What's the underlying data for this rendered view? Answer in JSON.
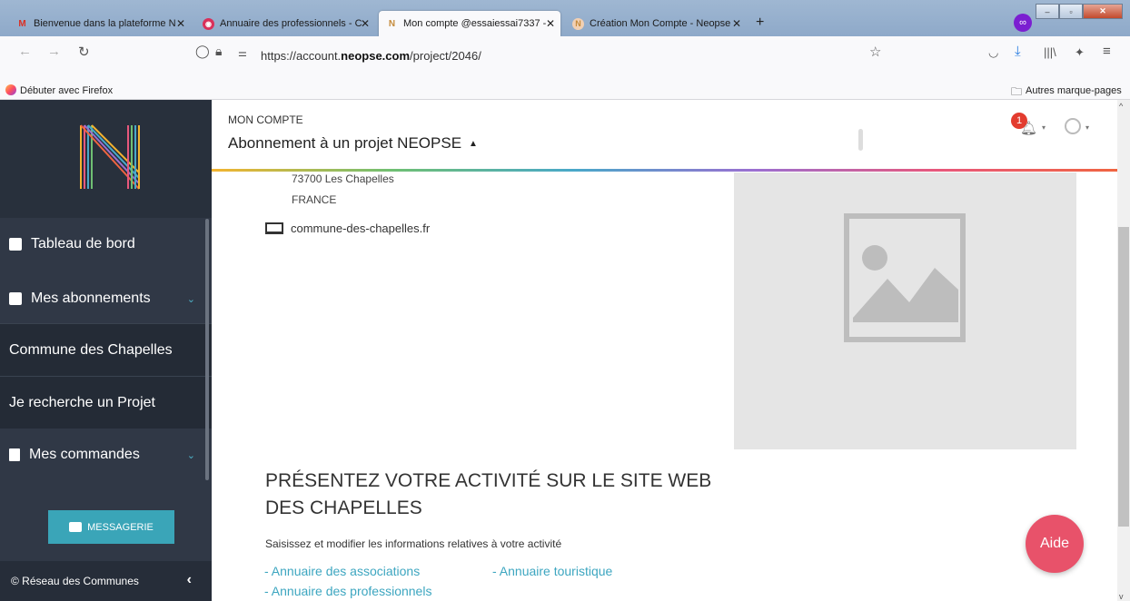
{
  "browser": {
    "tabs": [
      {
        "label": "Bienvenue dans la plateforme N",
        "icon": "gmail-icon"
      },
      {
        "label": "Annuaire des professionnels - C",
        "icon": "app-icon"
      },
      {
        "label": "Mon compte @essaiessai7337 -",
        "icon": "neopse-icon"
      },
      {
        "label": "Création Mon Compte - Neopse",
        "icon": "neopse-icon"
      }
    ],
    "url_prefix": "https://account.",
    "url_domain": "neopse.com",
    "url_suffix": "/project/2046/",
    "bookmark_left": "Débuter avec Firefox",
    "bookmark_right": "Autres marque-pages"
  },
  "sidebar": {
    "items": [
      {
        "label": "Tableau de bord"
      },
      {
        "label": "Mes abonnements"
      },
      {
        "label": "Commune des Chapelles"
      },
      {
        "label": "Je recherche un Projet"
      },
      {
        "label": "Mes commandes"
      }
    ],
    "message_button": "MESSAGERIE",
    "footer": "© Réseau des Communes"
  },
  "header": {
    "section": "MON COMPTE",
    "title": "Abonnement à un projet NEOPSE",
    "notification_count": "1"
  },
  "main": {
    "address_line1": "73700 Les Chapelles",
    "address_line2": "FRANCE",
    "website": "commune-des-chapelles.fr",
    "heading_line1": "PRÉSENTEZ VOTRE ACTIVITÉ SUR LE SITE WEB",
    "heading_line2": "DES CHAPELLES",
    "description": "Saisissez et modifier les informations relatives à votre activité",
    "links": [
      "- Annuaire des associations",
      "- Annuaire touristique",
      "- Annuaire des professionnels"
    ],
    "help_button": "Aide"
  }
}
